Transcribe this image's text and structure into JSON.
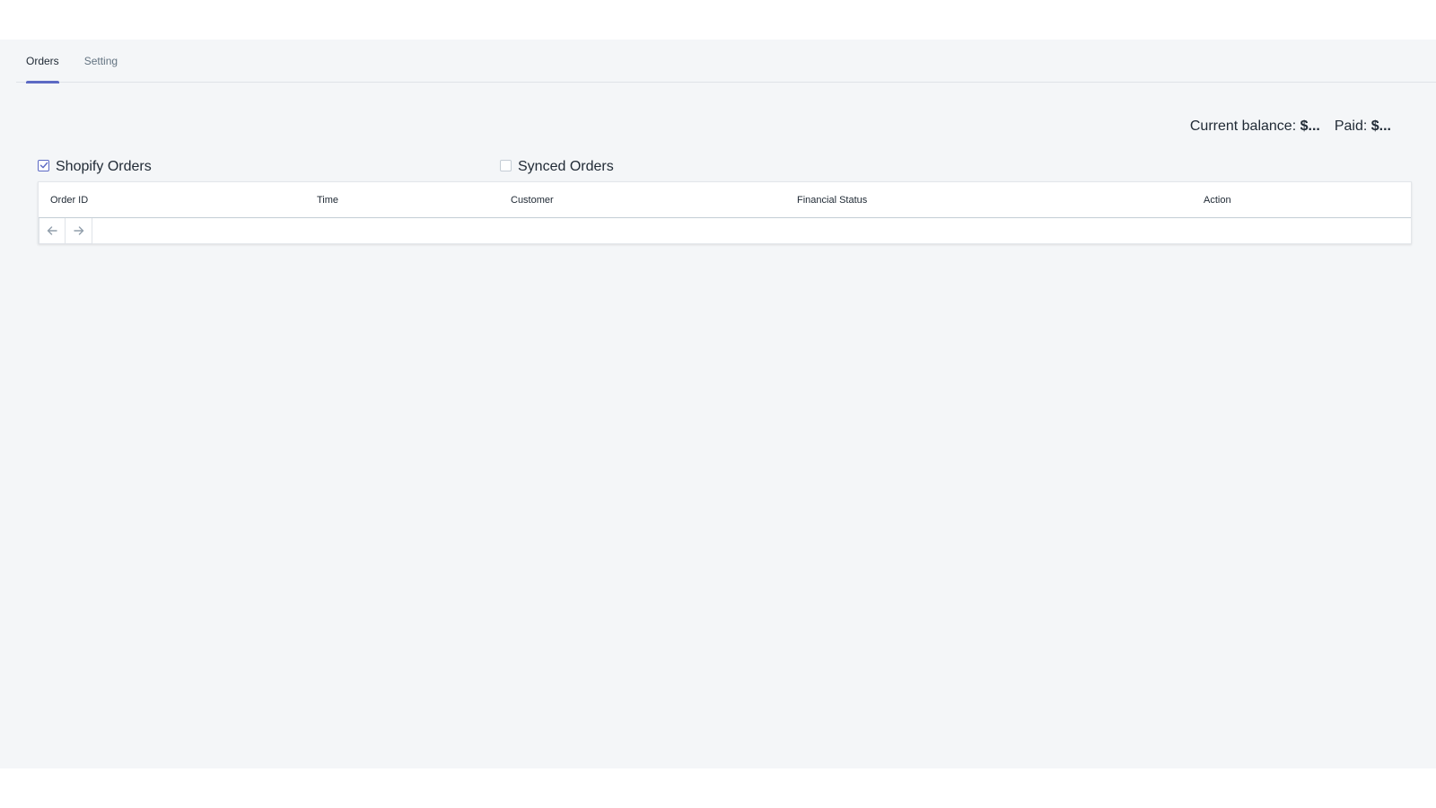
{
  "tabs": [
    {
      "label": "Orders",
      "active": true
    },
    {
      "label": "Setting",
      "active": false
    }
  ],
  "balance": {
    "current_label": "Current balance:",
    "current_value": "$...",
    "paid_label": "Paid:",
    "paid_value": "$..."
  },
  "filters": {
    "shopify": {
      "label": "Shopify Orders",
      "checked": true
    },
    "synced": {
      "label": "Synced Orders",
      "checked": false
    }
  },
  "table": {
    "columns": [
      "Order ID",
      "Time",
      "Customer",
      "Financial Status",
      "Action"
    ],
    "rows": []
  },
  "pagination": {
    "prev_icon": "arrow-left-icon",
    "next_icon": "arrow-right-icon"
  },
  "colors": {
    "accent": "#5c6ac4",
    "background": "#f4f6f8",
    "text": "#212b36",
    "muted": "#637381"
  }
}
